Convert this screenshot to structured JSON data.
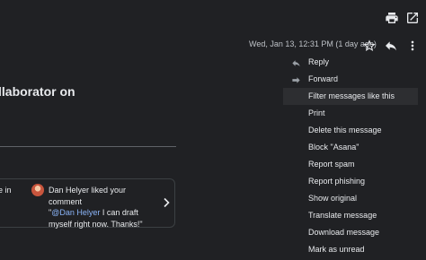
{
  "toolbar": {
    "print_icon": "print-icon",
    "open_new_window_icon": "open-in-new-window-icon"
  },
  "email": {
    "subject_fragment": "llaborator on",
    "timestamp": "Wed, Jan 13, 12:31 PM (1 day ago)",
    "star_icon": "star-icon",
    "reply_icon": "reply-icon",
    "more_icon": "more-vertical-icon"
  },
  "card": {
    "left_fragment": "e in",
    "comment_line1": "Dan Helyer liked your comment",
    "quote_open": "\"",
    "mention": "@Dan Helyer",
    "comment_rest": " I can draft myself right now. Thanks!\""
  },
  "menu": {
    "items": [
      {
        "label": "Reply",
        "icon": "reply-icon"
      },
      {
        "label": "Forward",
        "icon": "forward-icon"
      },
      {
        "label": "Filter messages like this"
      },
      {
        "label": "Print"
      },
      {
        "label": "Delete this message"
      },
      {
        "label": "Block \"Asana\""
      },
      {
        "label": "Report spam"
      },
      {
        "label": "Report phishing"
      },
      {
        "label": "Show original"
      },
      {
        "label": "Translate message"
      },
      {
        "label": "Download message"
      },
      {
        "label": "Mark as unread"
      }
    ]
  }
}
